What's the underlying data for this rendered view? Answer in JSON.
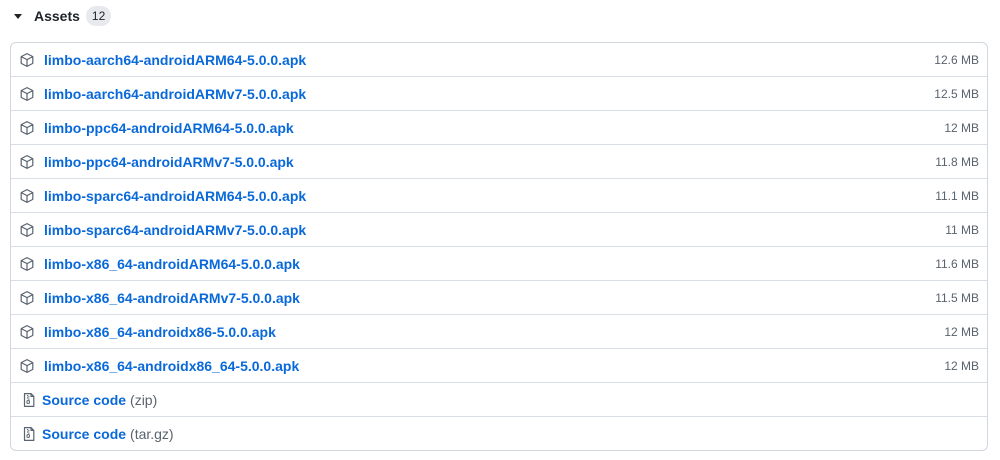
{
  "assets": {
    "title": "Assets",
    "count": "12",
    "files": [
      {
        "name": "limbo-aarch64-androidARM64-5.0.0.apk",
        "size": "12.6 MB"
      },
      {
        "name": "limbo-aarch64-androidARMv7-5.0.0.apk",
        "size": "12.5 MB"
      },
      {
        "name": "limbo-ppc64-androidARM64-5.0.0.apk",
        "size": "12 MB"
      },
      {
        "name": "limbo-ppc64-androidARMv7-5.0.0.apk",
        "size": "11.8 MB"
      },
      {
        "name": "limbo-sparc64-androidARM64-5.0.0.apk",
        "size": "11.1 MB"
      },
      {
        "name": "limbo-sparc64-androidARMv7-5.0.0.apk",
        "size": "11 MB"
      },
      {
        "name": "limbo-x86_64-androidARM64-5.0.0.apk",
        "size": "11.6 MB"
      },
      {
        "name": "limbo-x86_64-androidARMv7-5.0.0.apk",
        "size": "11.5 MB"
      },
      {
        "name": "limbo-x86_64-androidx86-5.0.0.apk",
        "size": "12 MB"
      },
      {
        "name": "limbo-x86_64-androidx86_64-5.0.0.apk",
        "size": "12 MB"
      }
    ],
    "source": [
      {
        "label": "Source code",
        "format": "(zip)"
      },
      {
        "label": "Source code",
        "format": "(tar.gz)"
      }
    ],
    "icons": {
      "file": "package-icon",
      "source": "file-zip-icon",
      "toggle": "triangle-down-icon"
    }
  }
}
